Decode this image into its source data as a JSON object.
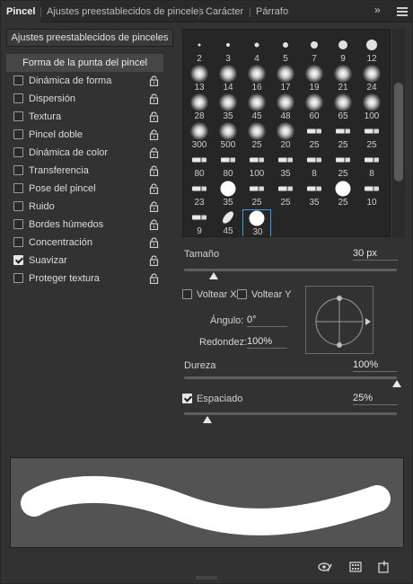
{
  "tabs": [
    {
      "label": "Pincel",
      "active": true
    },
    {
      "label": "Ajustes preestablecidos de pinceles",
      "active": false
    },
    {
      "label": "Carácter",
      "active": false
    },
    {
      "label": "Párrafo",
      "active": false
    }
  ],
  "presets_button": "Ajustes preestablecidos de pinceles",
  "settings_list": {
    "header": "Forma de la punta del pincel",
    "items": [
      {
        "label": "Dinámica de forma",
        "checked": false
      },
      {
        "label": "Dispersión",
        "checked": false
      },
      {
        "label": "Textura",
        "checked": false
      },
      {
        "label": "Pincel doble",
        "checked": false
      },
      {
        "label": "Dinámica de color",
        "checked": false
      },
      {
        "label": "Transferencia",
        "checked": false
      },
      {
        "label": "Pose del pincel",
        "checked": false
      },
      {
        "label": "Ruido",
        "checked": false
      },
      {
        "label": "Bordes húmedos",
        "checked": false
      },
      {
        "label": "Concentración",
        "checked": false
      },
      {
        "label": "Suavizar",
        "checked": true
      },
      {
        "label": "Proteger textura",
        "checked": false
      }
    ]
  },
  "brush_grid": {
    "rows": [
      [
        {
          "type": "hard",
          "size": "2"
        },
        {
          "type": "hard",
          "size": "3"
        },
        {
          "type": "hard",
          "size": "4"
        },
        {
          "type": "hard",
          "size": "5"
        },
        {
          "type": "hard",
          "size": "7"
        },
        {
          "type": "hard",
          "size": "9"
        },
        {
          "type": "hard",
          "size": "12"
        }
      ],
      [
        {
          "type": "soft",
          "size": "13"
        },
        {
          "type": "soft",
          "size": "14"
        },
        {
          "type": "soft",
          "size": "16"
        },
        {
          "type": "soft",
          "size": "17"
        },
        {
          "type": "soft",
          "size": "19"
        },
        {
          "type": "soft",
          "size": "21"
        },
        {
          "type": "soft",
          "size": "24"
        }
      ],
      [
        {
          "type": "soft",
          "size": "28"
        },
        {
          "type": "soft",
          "size": "35"
        },
        {
          "type": "soft",
          "size": "45"
        },
        {
          "type": "soft",
          "size": "48"
        },
        {
          "type": "soft",
          "size": "60"
        },
        {
          "type": "soft",
          "size": "65"
        },
        {
          "type": "soft",
          "size": "100"
        }
      ],
      [
        {
          "type": "soft",
          "size": "300"
        },
        {
          "type": "soft",
          "size": "500"
        },
        {
          "type": "soft",
          "size": "25"
        },
        {
          "type": "soft",
          "size": "20"
        },
        {
          "type": "tool",
          "size": "25"
        },
        {
          "type": "tool",
          "size": "25"
        },
        {
          "type": "tool",
          "size": "25"
        }
      ],
      [
        {
          "type": "tool",
          "size": "80"
        },
        {
          "type": "tool",
          "size": "80"
        },
        {
          "type": "tool",
          "size": "100"
        },
        {
          "type": "tool",
          "size": "35"
        },
        {
          "type": "tool",
          "size": "8"
        },
        {
          "type": "tool",
          "size": "25"
        },
        {
          "type": "tool",
          "size": "8"
        }
      ],
      [
        {
          "type": "tool",
          "size": "23"
        },
        {
          "type": "hardbig",
          "size": "35"
        },
        {
          "type": "tool",
          "size": "25"
        },
        {
          "type": "tool",
          "size": "25"
        },
        {
          "type": "tool",
          "size": "35"
        },
        {
          "type": "hardbig",
          "size": "25"
        },
        {
          "type": "tool",
          "size": "10"
        }
      ],
      [
        {
          "type": "tool",
          "size": "9"
        },
        {
          "type": "leaf",
          "size": "45"
        },
        {
          "type": "hardbig",
          "size": "30",
          "selected": true
        }
      ]
    ]
  },
  "size": {
    "label": "Tamaño",
    "value": "30 px",
    "fraction": 0.14
  },
  "flip_x": {
    "label": "Voltear X",
    "checked": false
  },
  "flip_y": {
    "label": "Voltear Y",
    "checked": false
  },
  "angle": {
    "label": "Ángulo:",
    "value": "0°"
  },
  "roundness": {
    "label": "Redondez:",
    "value": "100%"
  },
  "hardness": {
    "label": "Dureza",
    "value": "100%",
    "fraction": 1.0
  },
  "spacing": {
    "label": "Espaciado",
    "value": "25%",
    "checked": true,
    "fraction": 0.11
  },
  "colors": {
    "accent": "#3d9be9",
    "panel": "#323232",
    "preview_bg": "#535353"
  }
}
